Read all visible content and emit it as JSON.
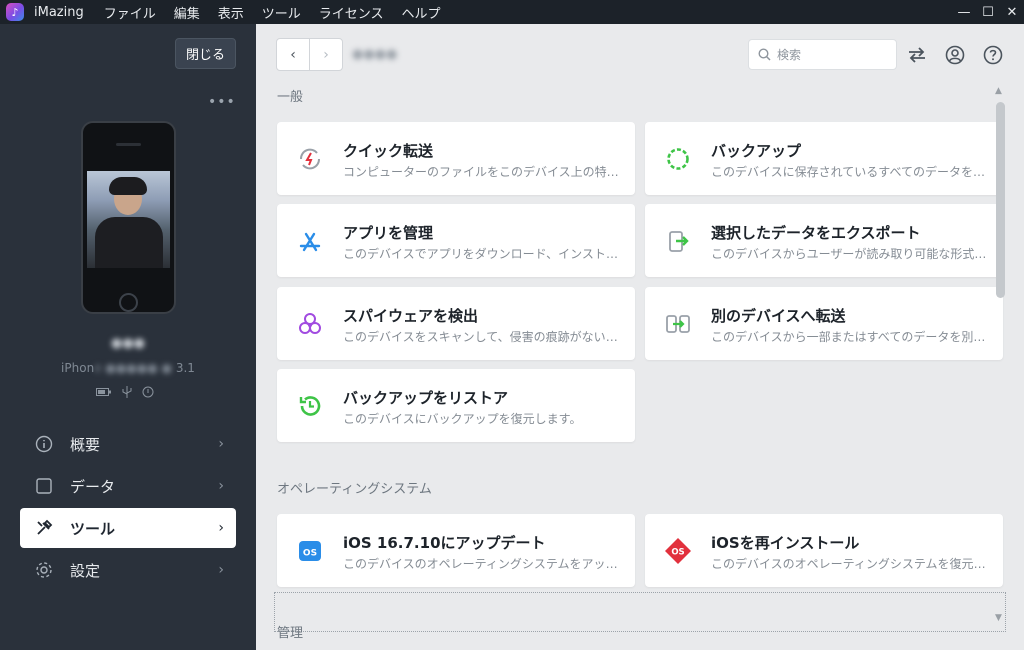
{
  "titlebar": {
    "app_name": "iMazing",
    "menu": [
      "ファイル",
      "編集",
      "表示",
      "ツール",
      "ライセンス",
      "ヘルプ"
    ],
    "controls": {
      "minimize": "—",
      "maximize": "☐",
      "close": "✕"
    }
  },
  "sidebar": {
    "close_label": "閉じる",
    "more_label": "•••",
    "device_name": "●●●",
    "device_model_prefix": "iPhon",
    "device_model_blur": "e ●●●●● ●",
    "device_model_suffix": "3.1",
    "nav": [
      {
        "label": "概要",
        "icon": "info-icon"
      },
      {
        "label": "データ",
        "icon": "square-icon"
      },
      {
        "label": "ツール",
        "icon": "tools-icon",
        "active": true
      },
      {
        "label": "設定",
        "icon": "gear-icon"
      }
    ]
  },
  "header": {
    "back": "‹",
    "forward": "›",
    "breadcrumb": "●●●●",
    "search_placeholder": "検索"
  },
  "sections": {
    "general": "一般",
    "os": "オペレーティングシステム",
    "manage": "管理"
  },
  "cards": {
    "quick_transfer": {
      "title": "クイック転送",
      "desc": "コンピューターのファイルをこのデバイス上の特定のアプリに転送します。"
    },
    "backup": {
      "title": "バックアップ",
      "desc": "このデバイスに保存されているすべてのデータをバックアップします。"
    },
    "manage_apps": {
      "title": "アプリを管理",
      "desc": "このデバイスでアプリをダウンロード、インストール、バックアップします。"
    },
    "export_data": {
      "title": "選択したデータをエクスポート",
      "desc": "このデバイスからユーザーが読み取り可能な形式でデータをエクスポートします。"
    },
    "transfer_device": {
      "title": "別のデバイスへ転送",
      "desc": "このデバイスから一部またはすべてのデータを別のデバイスに転送します。"
    },
    "spyware": {
      "title": "スパイウェアを検出",
      "desc": "このデバイスをスキャンして、侵害の痕跡がないか確認します。"
    },
    "restore": {
      "title": "バックアップをリストア",
      "desc": "このデバイスにバックアップを復元します。"
    },
    "ios_update": {
      "title": "iOS 16.7.10にアップデート",
      "desc": "このデバイスのオペレーティングシステムをアップデートします。"
    },
    "ios_reinstall": {
      "title": "iOSを再インストール",
      "desc": "このデバイスのオペレーティングシステムを復元します。"
    }
  },
  "colors": {
    "sidebar_bg": "#2a313b",
    "main_bg": "#e9eaec",
    "accent_blue": "#2a8de8",
    "accent_green": "#3ec447",
    "accent_purple": "#a14be0",
    "accent_red": "#e2313d"
  }
}
